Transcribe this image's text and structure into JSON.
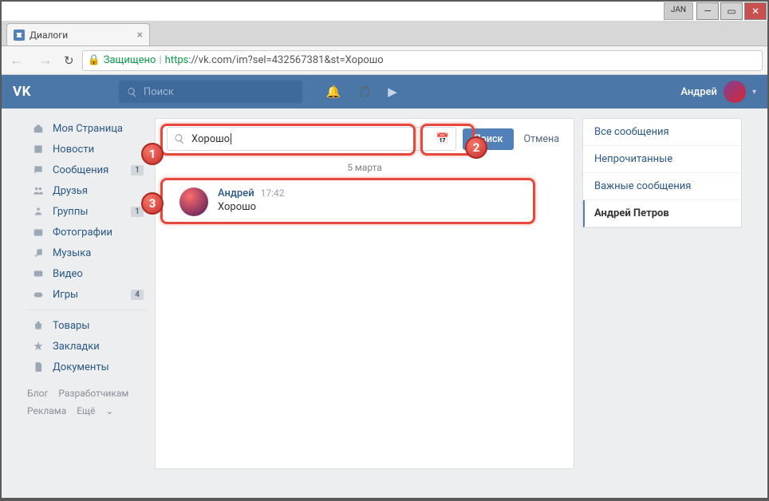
{
  "os": {
    "jan": "JAN",
    "min": "—",
    "max": "▭",
    "close": "✕"
  },
  "browser": {
    "tab_title": "Диалоги",
    "tab_close": "×",
    "secure_label": "Защищено",
    "url_proto": "https",
    "url_host": "://vk.com",
    "url_path": "/im?sel=432567381&st=Хорошо",
    "nav_back": "←",
    "nav_fwd": "→",
    "reload": "↻"
  },
  "header": {
    "logo": "VK",
    "search_placeholder": "Поиск",
    "user_name": "Андрей",
    "chevron": "▾"
  },
  "sidebar": {
    "items": [
      {
        "icon": "home",
        "label": "Моя Страница"
      },
      {
        "icon": "news",
        "label": "Новости"
      },
      {
        "icon": "msg",
        "label": "Сообщения",
        "badge": "1"
      },
      {
        "icon": "friends",
        "label": "Друзья"
      },
      {
        "icon": "groups",
        "label": "Группы",
        "badge": "1"
      },
      {
        "icon": "photo",
        "label": "Фотографии"
      },
      {
        "icon": "music",
        "label": "Музыка"
      },
      {
        "icon": "video",
        "label": "Видео"
      },
      {
        "icon": "games",
        "label": "Игры",
        "badge": "4"
      }
    ],
    "items2": [
      {
        "icon": "market",
        "label": "Товары"
      },
      {
        "icon": "bookmark",
        "label": "Закладки"
      },
      {
        "icon": "docs",
        "label": "Документы"
      }
    ],
    "footer": {
      "blog": "Блог",
      "dev": "Разработчикам",
      "ads": "Реклама",
      "more": "Ещё",
      "more_caret": "⌄"
    }
  },
  "im": {
    "search_value": "Хорошо",
    "search_btn": "Поиск",
    "cancel_btn": "Отмена",
    "date_sep": "5 марта",
    "result": {
      "name": "Андрей",
      "time": "17:42",
      "text": "Хорошо"
    }
  },
  "filters": {
    "all": "Все сообщения",
    "unread": "Непрочитанные",
    "important": "Важные сообщения",
    "active": "Андрей Петров"
  },
  "annot": {
    "b1": "1",
    "b2": "2",
    "b3": "3"
  }
}
